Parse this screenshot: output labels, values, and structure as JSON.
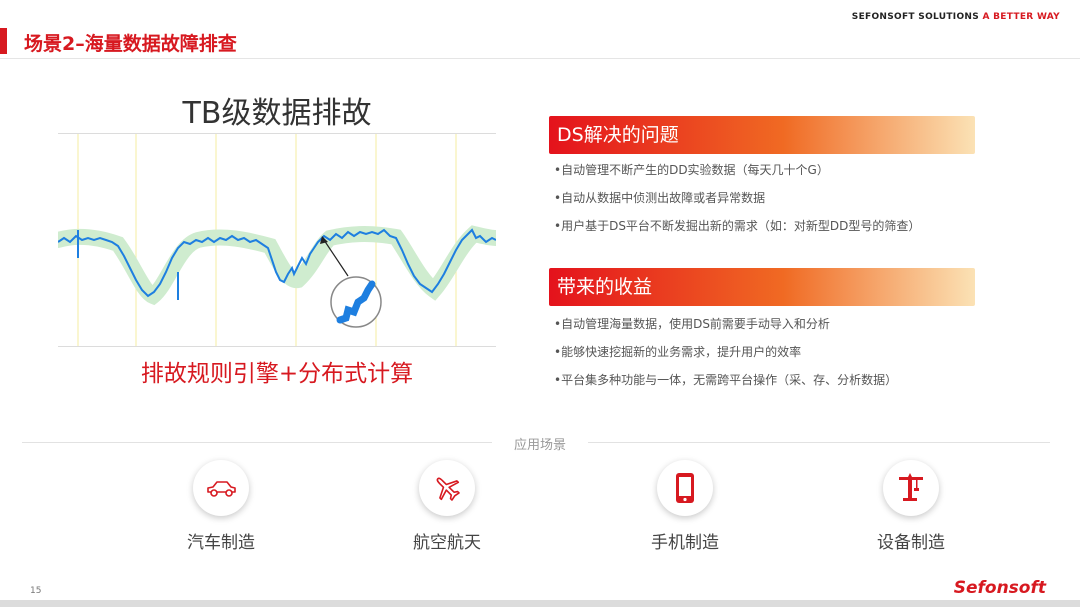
{
  "header": {
    "brand": "SEFONSOFT SOLUTIONS",
    "brand_tagline": "A BETTER WAY",
    "title": "场景2–海量数据故障排查"
  },
  "chart": {
    "title": "TB级数据排故",
    "caption": "排故规则引擎+分布式计算"
  },
  "panels": [
    {
      "title": "DS解决的问题",
      "items": [
        "•自动管理不断产生的DD实验数据（每天几十个G）",
        "•自动从数据中侦测出故障或者异常数据",
        "•用户基于DS平台不断发掘出新的需求（如：对新型DD型号的筛查）"
      ]
    },
    {
      "title": "带来的收益",
      "items": [
        "•自动管理海量数据，使用DS前需要手动导入和分析",
        "•能够快速挖掘新的业务需求，提升用户的效率",
        "•平台集多种功能与一体，无需跨平台操作（采、存、分析数据）"
      ]
    }
  ],
  "scenarios_label": "应用场景",
  "scenarios": [
    {
      "label": "汽车制造",
      "icon": "car-icon"
    },
    {
      "label": "航空航天",
      "icon": "airplane-icon"
    },
    {
      "label": "手机制造",
      "icon": "mobile-phone-icon"
    },
    {
      "label": "设备制造",
      "icon": "crane-icon"
    }
  ],
  "footer": {
    "page_number": "15",
    "logo": "Sefonsoft"
  },
  "colors": {
    "brand_red": "#d71920",
    "signal_blue": "#1e7fe0",
    "band_green": "#cfeccf"
  }
}
